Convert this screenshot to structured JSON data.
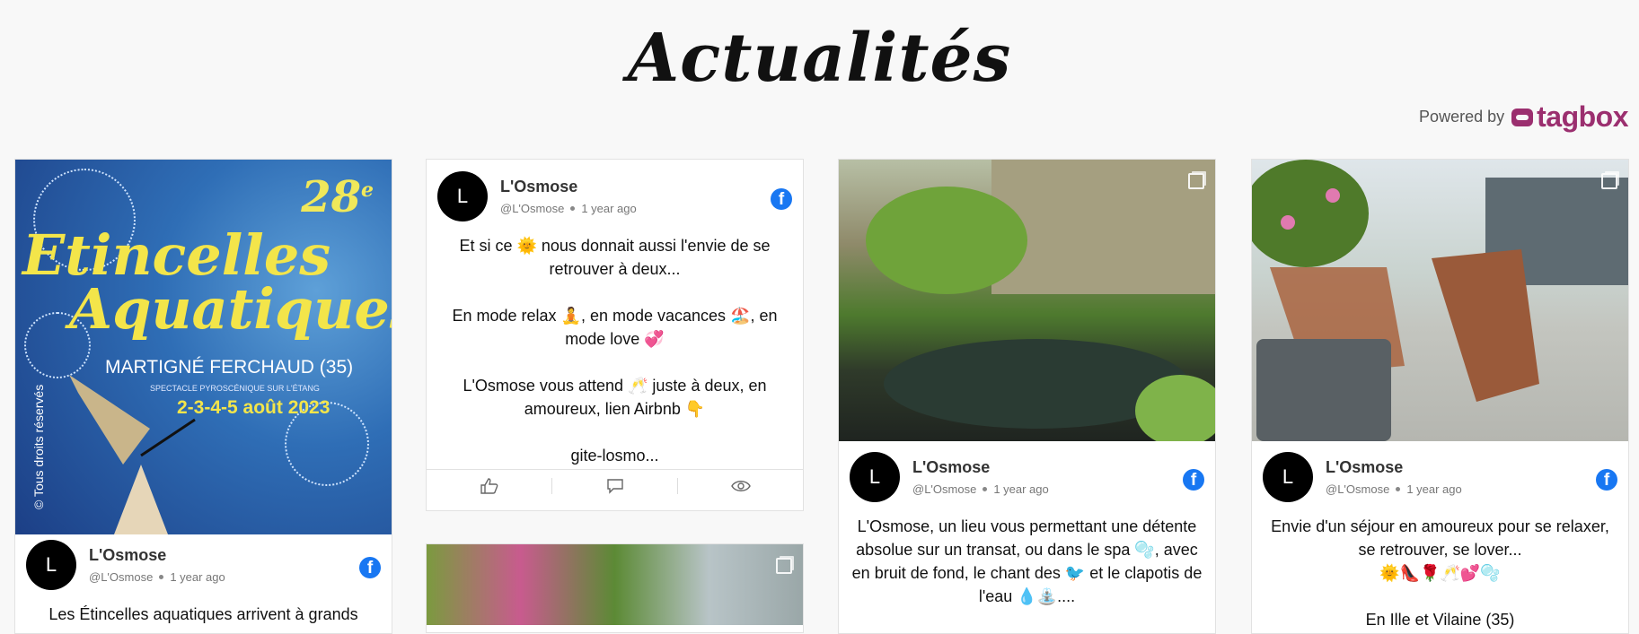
{
  "page": {
    "title": "Actualités"
  },
  "powered": {
    "label": "Powered by",
    "brand": "tagbox",
    "brand_color": "#9b2f6f"
  },
  "posts": [
    {
      "author": "L'Osmose",
      "avatar_letter": "L",
      "handle": "@L'Osmose",
      "time": "1 year ago",
      "network_icon": "facebook-icon",
      "image": {
        "desc_icon": "event-poster",
        "poster_number": "28",
        "poster_sup": "e",
        "poster_line1": "Etincelles",
        "poster_line2": "Aquatiques",
        "poster_place": "MARTIGNÉ FERCHAUD (35)",
        "poster_sub": "SPECTACLE PYROSCÉNIQUE SUR L'ÉTANG",
        "poster_dates": "2-3-4-5 août 2023",
        "poster_rights": "© Tous droits réservés"
      },
      "text": "Les Étincelles aquatiques arrivent à grands pas..."
    },
    {
      "author": "L'Osmose",
      "avatar_letter": "L",
      "handle": "@L'Osmose",
      "time": "1 year ago",
      "network_icon": "facebook-icon",
      "paragraphs": [
        "Et si ce 🌞 nous donnait aussi l'envie de se retrouver à deux...",
        "En mode relax 🧘, en mode vacances 🏖️, en mode love 💞",
        "L'Osmose vous attend 🥂 juste à deux, en amoureux, lien Airbnb 👇",
        "gite-losmo..."
      ],
      "actions": [
        "like-icon",
        "comment-icon",
        "view-icon"
      ]
    },
    {
      "author": "L'Osmose",
      "avatar_letter": "L",
      "handle": "@L'Osmose",
      "time": "1 year ago",
      "network_icon": "facebook-icon",
      "image": {
        "desc_icon": "garden-pond-photo"
      },
      "text": "L'Osmose, un lieu vous permettant une détente absolue sur un transat, ou dans le spa 🫧, avec en bruit de fond, le chant des 🐦 et le clapotis de l'eau 💧⛲...."
    },
    {
      "author": "L'Osmose",
      "avatar_letter": "L",
      "handle": "@L'Osmose",
      "time": "1 year ago",
      "network_icon": "facebook-icon",
      "image": {
        "desc_icon": "patio-chairs-photo"
      },
      "text": "Envie d'un séjour en amoureux pour se relaxer, se retrouver, se lover...",
      "emoji_line": "🌞👠🌹🥂💕🫧",
      "text2": "En Ille et Vilaine (35)"
    },
    {
      "image": {
        "desc_icon": "flowers-photo"
      }
    }
  ]
}
